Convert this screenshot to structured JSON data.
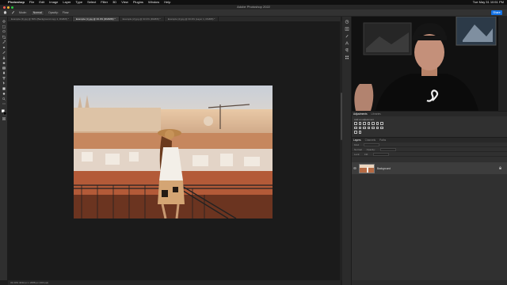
{
  "menubar": {
    "items": [
      "Photoshop",
      "File",
      "Edit",
      "Image",
      "Layer",
      "Type",
      "Select",
      "Filter",
      "3D",
      "View",
      "Plugins",
      "Window",
      "Help"
    ],
    "clock": "Tue May 31 10:51 PM"
  },
  "window": {
    "title": "Adobe Photoshop 2022"
  },
  "options_bar": {
    "mode_label": "Mode:",
    "mode_value": "Normal",
    "opacity_label": "Opacity:",
    "flow_label": "Flow:",
    "share_label": "Share"
  },
  "tabs": [
    {
      "label": "Example (3).jpg @ 50% (Background copy 2, RGB/8) *",
      "active": false
    },
    {
      "label": "Example (1).jpg @ 33.3% (RGB/8#) *",
      "active": true
    },
    {
      "label": "Example (2).jpg @ 33.3% (RGB/8) *",
      "active": false
    },
    {
      "label": "Example (4).jpg @ 33.3% (Layer 1, RGB/8) *",
      "active": false
    }
  ],
  "statusbar": {
    "text": "33.33%    4032 px x 2688 px (300 ppi)"
  },
  "adjustments_panel": {
    "tabs": [
      {
        "label": "Adjustments",
        "active": true
      },
      {
        "label": "Libraries",
        "active": false
      }
    ],
    "add_label": "Add an adjustment"
  },
  "layers_panel": {
    "tabs": [
      {
        "label": "Layers",
        "active": true
      },
      {
        "label": "Channels",
        "active": false
      },
      {
        "label": "Paths",
        "active": false
      }
    ],
    "kind_label": "Kind",
    "mode_value": "Normal",
    "opacity_label": "Opacity:",
    "lock_label": "Lock:",
    "fill_label": "Fill:",
    "layer_name": "Background"
  },
  "colors": {
    "accent": "#1473e6",
    "panel": "#303030",
    "canvas": "#1b1b1b",
    "menubar": "#101010"
  },
  "icons": [
    "apple-icon",
    "brush-icon",
    "move-tool-icon",
    "marquee-tool-icon",
    "lasso-tool-icon",
    "crop-tool-icon",
    "eyedropper-icon",
    "healing-brush-icon",
    "brush-tool-icon",
    "stamp-tool-icon",
    "eraser-tool-icon",
    "gradient-tool-icon",
    "pen-tool-icon",
    "type-tool-icon",
    "path-selection-icon",
    "shape-tool-icon",
    "hand-tool-icon",
    "zoom-tool-icon",
    "eye-icon",
    "lock-icon"
  ]
}
